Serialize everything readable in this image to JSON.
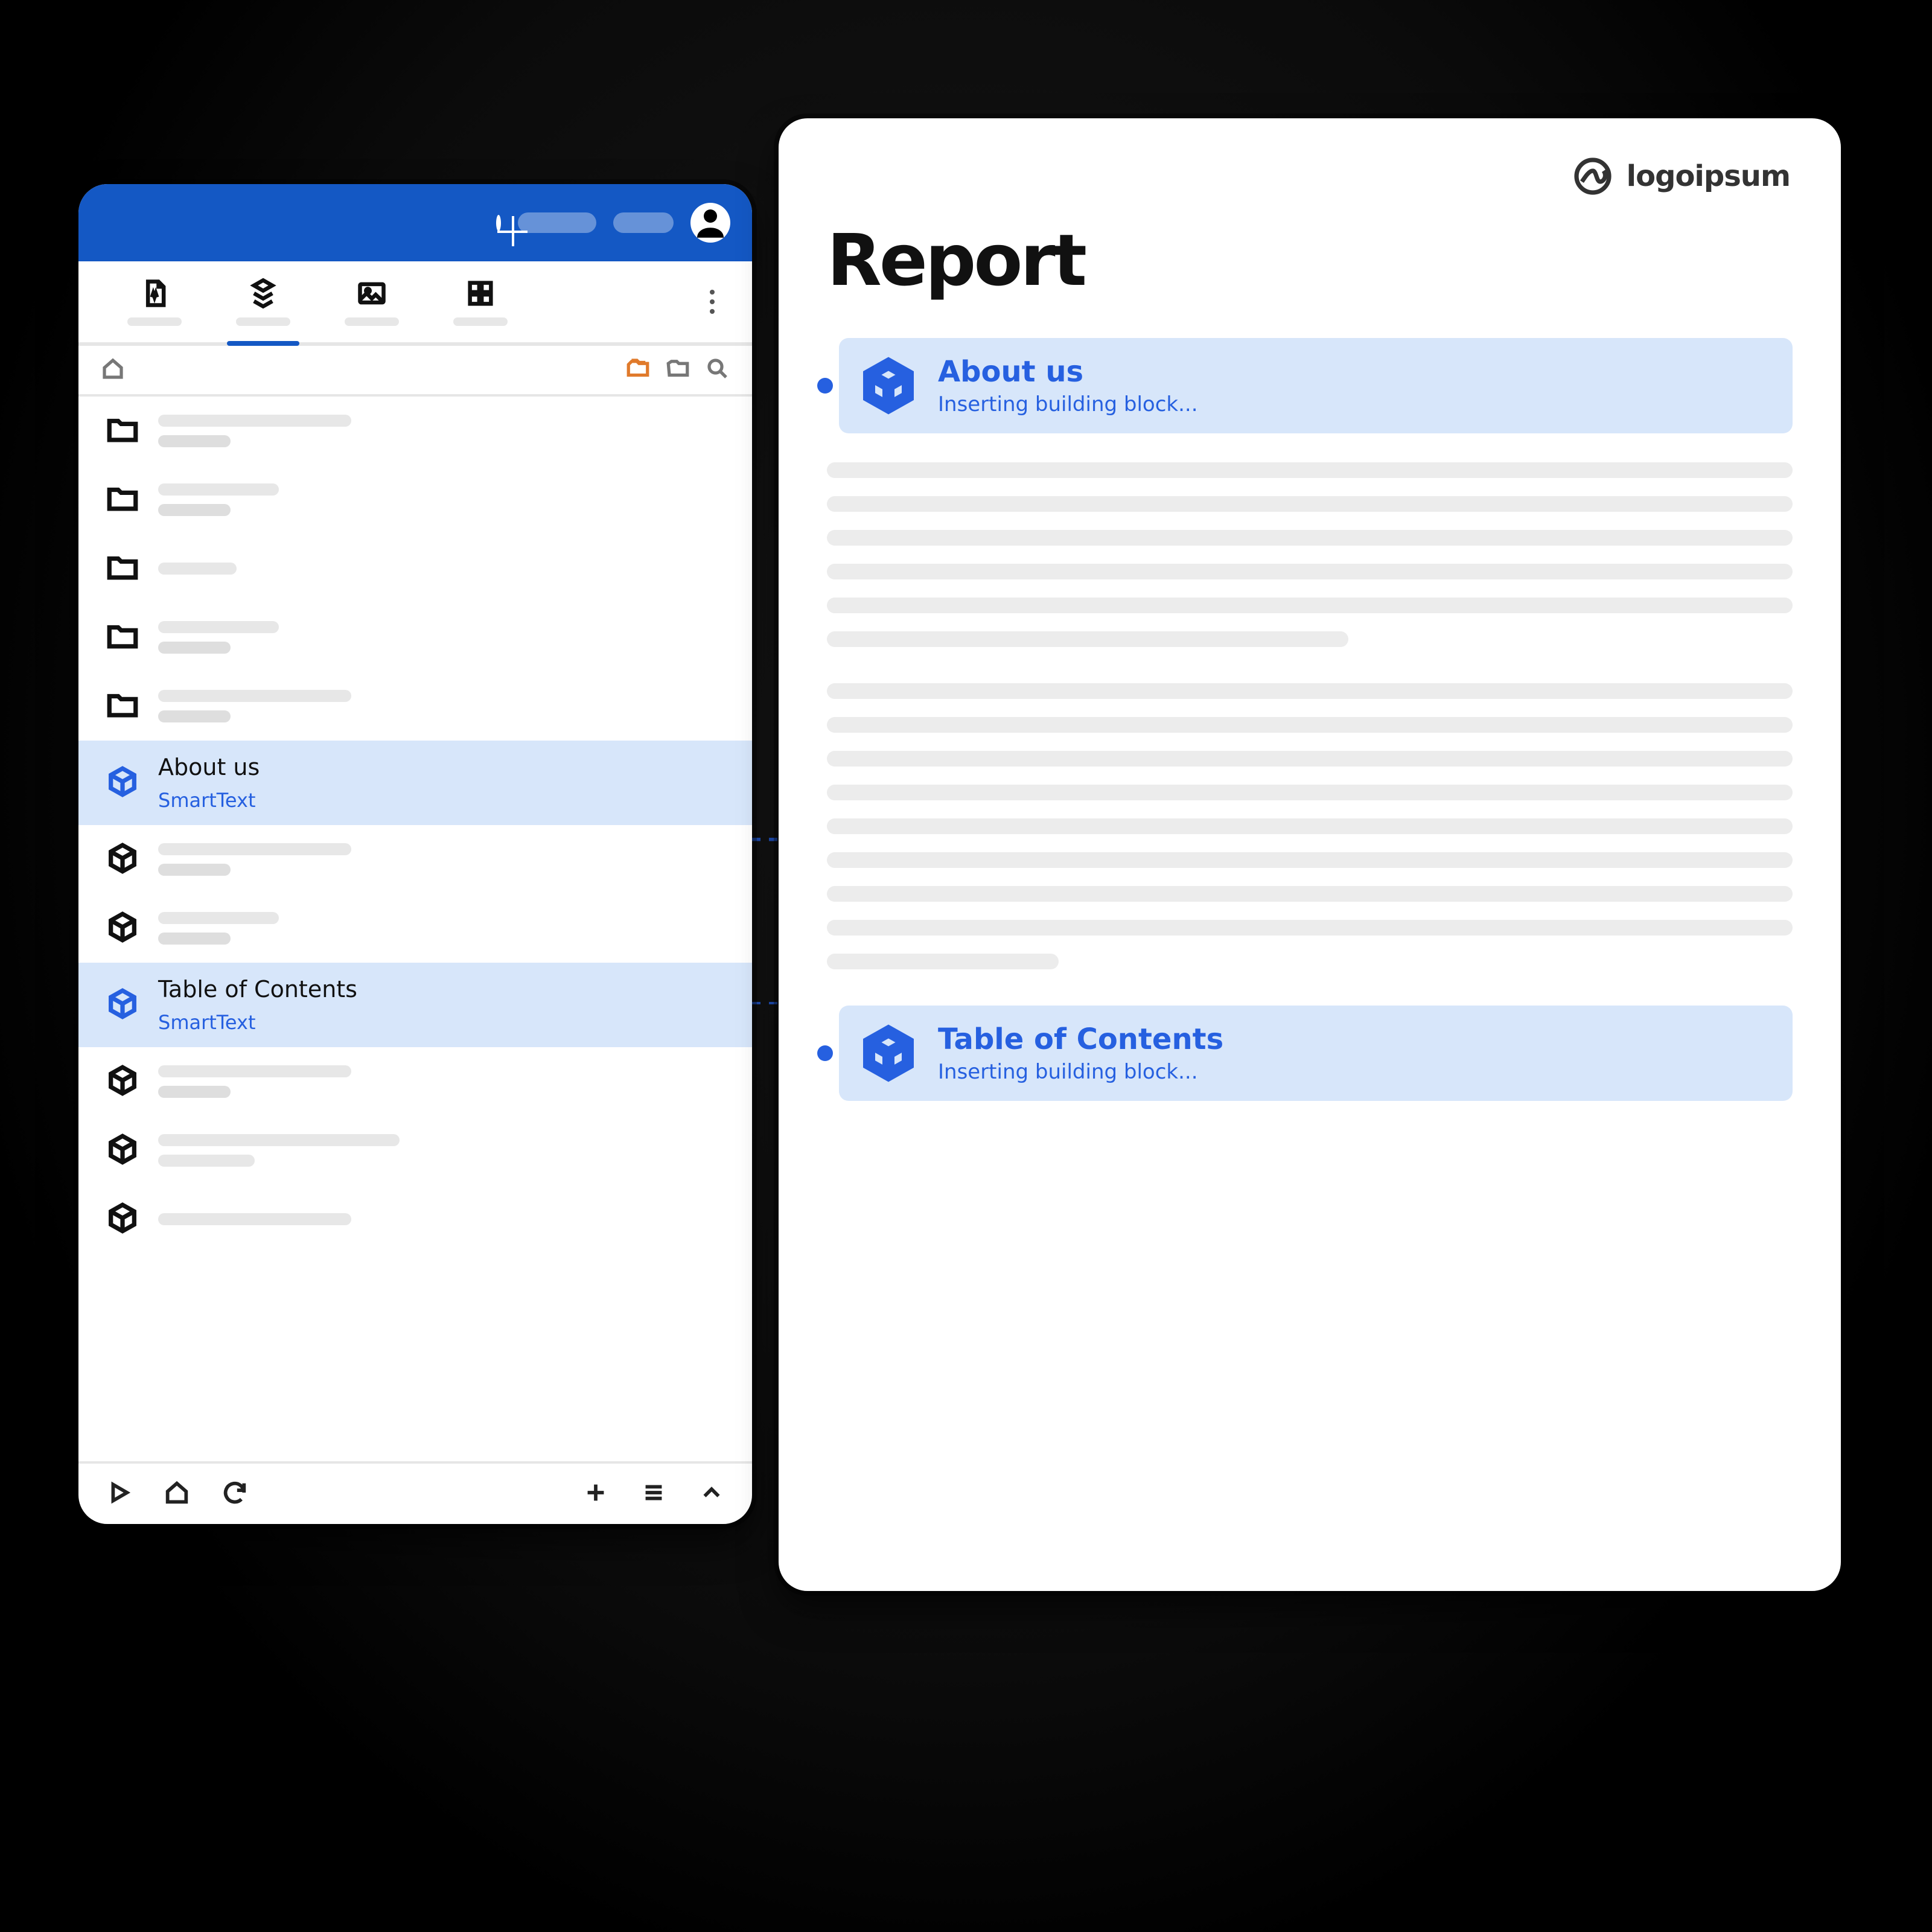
{
  "colors": {
    "blue": "#1458c4",
    "accent": "#2660e0",
    "blockBg": "#d7e6fa",
    "orange": "#e07a2b"
  },
  "leftPanel": {
    "items": {
      "aboutUs": {
        "title": "About us",
        "subtitle": "SmartText"
      },
      "toc": {
        "title": "Table of Contents",
        "subtitle": "SmartText"
      }
    }
  },
  "rightPanel": {
    "logoText": "logoipsum",
    "heading": "Report",
    "blocks": {
      "aboutUs": {
        "title": "About us",
        "status": "Inserting building block..."
      },
      "toc": {
        "title": "Table of Contents",
        "status": "Inserting building block..."
      }
    }
  }
}
